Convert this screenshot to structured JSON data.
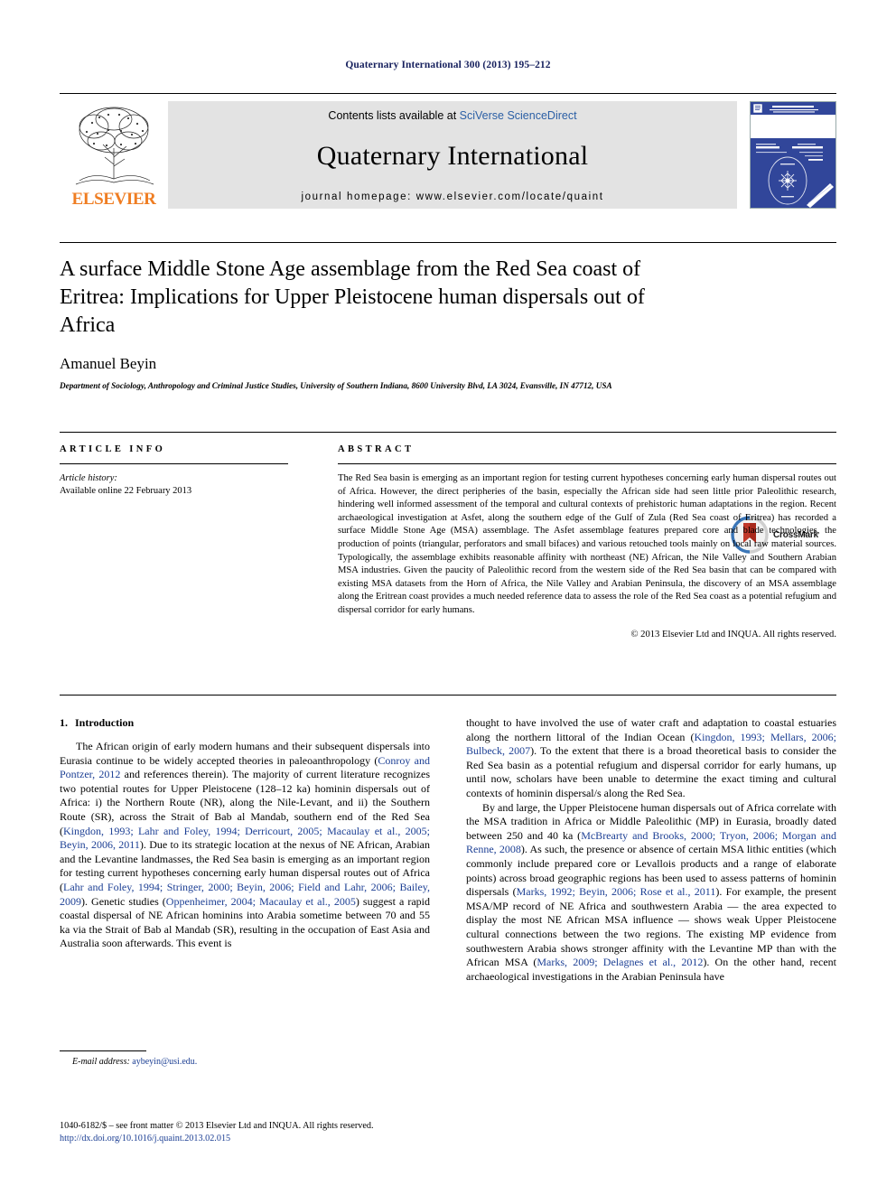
{
  "running_head": "Quaternary International 300 (2013) 195–212",
  "masthead": {
    "publisher_logo_name": "elsevier-tree-logo",
    "publisher_word": "ELSEVIER",
    "contents_prefix": "Contents lists available at ",
    "contents_link": "SciVerse ScienceDirect",
    "journal_title": "Quaternary International",
    "homepage": "journal homepage: www.elsevier.com/locate/quaint",
    "cover_thumb_name": "journal-cover-thumbnail"
  },
  "article": {
    "title": "A surface Middle Stone Age assemblage from the Red Sea coast of Eritrea: Implications for Upper Pleistocene human dispersals out of Africa",
    "author": "Amanuel Beyin",
    "affiliation": "Department of Sociology, Anthropology and Criminal Justice Studies, University of Southern Indiana, 8600 University Blvd, LA 3024, Evansville, IN 47712, USA",
    "crossmark_label": "CrossMark"
  },
  "info": {
    "heading": "ARTICLE INFO",
    "history_label": "Article history:",
    "history_value": "Available online 22 February 2013"
  },
  "abstract": {
    "heading": "ABSTRACT",
    "text": "The Red Sea basin is emerging as an important region for testing current hypotheses concerning early human dispersal routes out of Africa. However, the direct peripheries of the basin, especially the African side had seen little prior Paleolithic research, hindering well informed assessment of the temporal and cultural contexts of prehistoric human adaptations in the region. Recent archaeological investigation at Asfet, along the southern edge of the Gulf of Zula (Red Sea coast of Eritrea) has recorded a surface Middle Stone Age (MSA) assemblage. The Asfet assemblage features prepared core and blade technologies, the production of points (triangular, perforators and small bifaces) and various retouched tools mainly on local raw material sources. Typologically, the assemblage exhibits reasonable affinity with northeast (NE) African, the Nile Valley and Southern Arabian MSA industries. Given the paucity of Paleolithic record from the western side of the Red Sea basin that can be compared with existing MSA datasets from the Horn of Africa, the Nile Valley and Arabian Peninsula, the discovery of an MSA assemblage along the Eritrean coast provides a much needed reference data to assess the role of the Red Sea coast as a potential refugium and dispersal corridor for early humans.",
    "copyright": "© 2013 Elsevier Ltd and INQUA. All rights reserved."
  },
  "body": {
    "section_number": "1.",
    "section_title": "Introduction",
    "left_paragraph_1": "The African origin of early modern humans and their subsequent dispersals into Eurasia continue to be widely accepted theories in paleoanthropology (Conroy and Pontzer, 2012 and references therein). The majority of current literature recognizes two potential routes for Upper Pleistocene (128–12 ka) hominin dispersals out of Africa: i) the Northern Route (NR), along the Nile-Levant, and ii) the Southern Route (SR), across the Strait of Bab al Mandab, southern end of the Red Sea (Kingdon, 1993; Lahr and Foley, 1994; Derricourt, 2005; Macaulay et al., 2005; Beyin, 2006, 2011). Due to its strategic location at the nexus of NE African, Arabian and the Levantine landmasses, the Red Sea basin is emerging as an important region for testing current hypotheses concerning early human dispersal routes out of Africa (Lahr and Foley, 1994; Stringer, 2000; Beyin, 2006; Field and Lahr, 2006; Bailey, 2009). Genetic studies (Oppenheimer, 2004; Macaulay et al., 2005) suggest a rapid coastal dispersal of NE African hominins into Arabia sometime between 70 and 55 ka via the Strait of Bab al Mandab (SR), resulting in the occupation of East Asia and Australia soon afterwards. This event is",
    "right_paragraph_1": "thought to have involved the use of water craft and adaptation to coastal estuaries along the northern littoral of the Indian Ocean (Kingdon, 1993; Mellars, 2006; Bulbeck, 2007). To the extent that there is a broad theoretical basis to consider the Red Sea basin as a potential refugium and dispersal corridor for early humans, up until now, scholars have been unable to determine the exact timing and cultural contexts of hominin dispersal/s along the Red Sea.",
    "right_paragraph_2": "By and large, the Upper Pleistocene human dispersals out of Africa correlate with the MSA tradition in Africa or Middle Paleolithic (MP) in Eurasia, broadly dated between 250 and 40 ka (McBrearty and Brooks, 2000; Tryon, 2006; Morgan and Renne, 2008). As such, the presence or absence of certain MSA lithic entities (which commonly include prepared core or Levallois products and a range of elaborate points) across broad geographic regions has been used to assess patterns of hominin dispersals (Marks, 1992; Beyin, 2006; Rose et al., 2011). For example, the present MSA/MP record of NE Africa and southwestern Arabia — the area expected to display the most NE African MSA influence — shows weak Upper Pleistocene cultural connections between the two regions. The existing MP evidence from southwestern Arabia shows stronger affinity with the Levantine MP than with the African MSA (Marks, 2009; Delagnes et al., 2012). On the other hand, recent archaeological investigations in the Arabian Peninsula have"
  },
  "footnote": {
    "label": "E-mail address:",
    "email": "aybeyin@usi.edu."
  },
  "bottom": {
    "issn_line": "1040-6182/$ – see front matter © 2013 Elsevier Ltd and INQUA. All rights reserved.",
    "doi": "http://dx.doi.org/10.1016/j.quaint.2013.02.015"
  },
  "colors": {
    "link_blue": "#1c3f94",
    "sciencedirect_blue": "#2b5fa5",
    "elsevier_orange": "#ef7d22",
    "cover_blue": "#31469a",
    "running_head": "#17215e"
  }
}
